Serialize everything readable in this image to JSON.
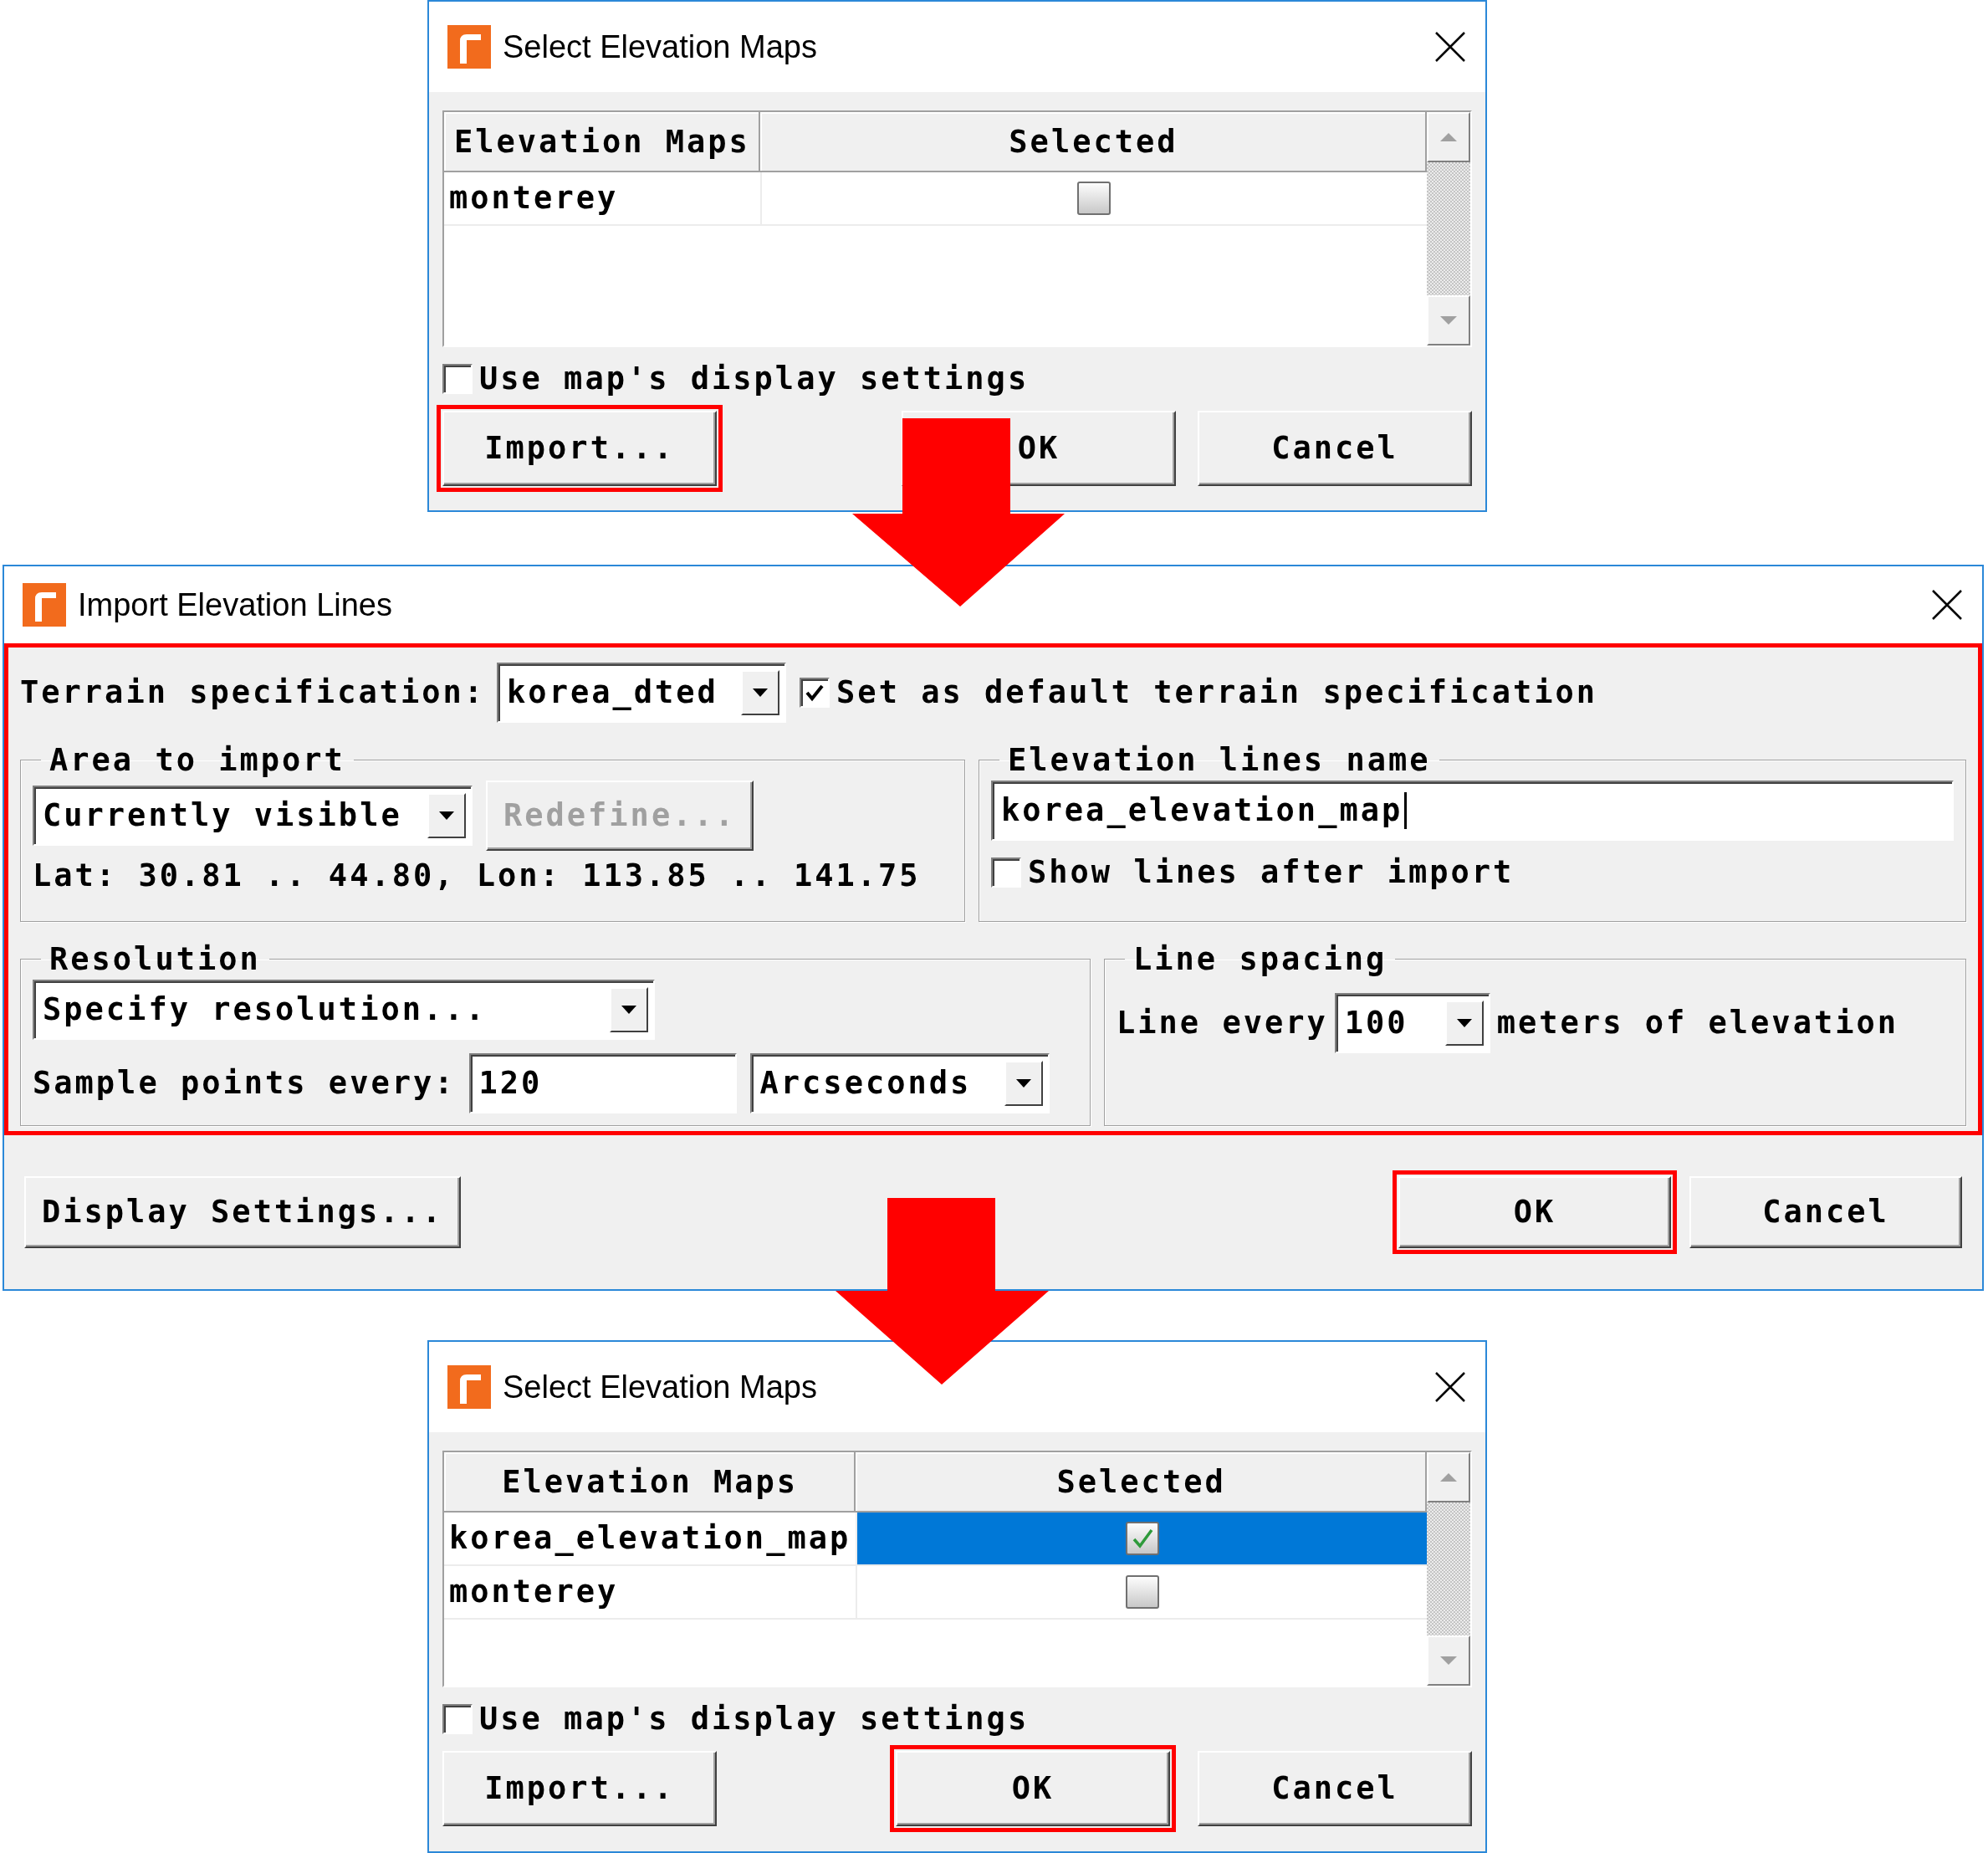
{
  "dialogs": [
    {
      "kind": "select_maps",
      "title": "Select Elevation Maps",
      "columns": [
        "Elevation Maps",
        "Selected"
      ],
      "rows": [
        {
          "name": "monterey",
          "checked": false,
          "selected": false
        }
      ],
      "option": {
        "label": "Use map's display settings",
        "checked": false
      },
      "buttons": [
        {
          "label": "Import...",
          "highlighted": true
        },
        {
          "label": "OK",
          "highlighted": false
        },
        {
          "label": "Cancel",
          "highlighted": false
        }
      ]
    },
    {
      "kind": "import_lines",
      "title": "Import Elevation Lines",
      "highlighted": true,
      "terrain": {
        "label": "Terrain specification:",
        "value": "korea_dted"
      },
      "default_option": {
        "label": "Set as default terrain specification",
        "checked": true
      },
      "area": {
        "title": "Area to import",
        "mode": "Currently visible",
        "redefine": {
          "label": "Redefine...",
          "disabled": true
        },
        "bounds": "Lat: 30.81 .. 44.80, Lon: 113.85 .. 141.75"
      },
      "name_group": {
        "title": "Elevation lines name",
        "value": "korea_elevation_map",
        "show_option": {
          "label": "Show lines after import",
          "checked": false
        }
      },
      "resolution": {
        "title": "Resolution",
        "mode": "Specify resolution...",
        "sample_label": "Sample points every:",
        "sample_value": "120",
        "unit": "Arcseconds"
      },
      "spacing": {
        "title": "Line spacing",
        "prefix": "Line every",
        "value": "100",
        "suffix": "meters of elevation"
      },
      "buttons": [
        {
          "label": "Display Settings...",
          "highlighted": false
        },
        {
          "label": "OK",
          "highlighted": true
        },
        {
          "label": "Cancel",
          "highlighted": false
        }
      ]
    },
    {
      "kind": "select_maps",
      "title": "Select Elevation Maps",
      "columns": [
        "Elevation Maps",
        "Selected"
      ],
      "rows": [
        {
          "name": "korea_elevation_map",
          "checked": true,
          "selected": true
        },
        {
          "name": "monterey",
          "checked": false,
          "selected": false
        }
      ],
      "option": {
        "label": "Use map's display settings",
        "checked": false
      },
      "buttons": [
        {
          "label": "Import...",
          "highlighted": false
        },
        {
          "label": "OK",
          "highlighted": true
        },
        {
          "label": "Cancel",
          "highlighted": false
        }
      ]
    }
  ]
}
